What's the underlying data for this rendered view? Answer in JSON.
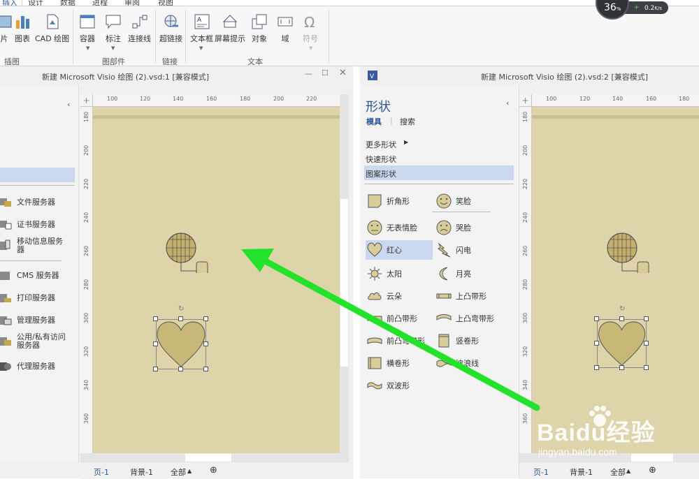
{
  "ribbon": {
    "tabs": [
      "插入",
      "设计",
      "数据",
      "进程",
      "审阅",
      "视图"
    ],
    "buttons": [
      {
        "label": "片"
      },
      {
        "label": "图表"
      },
      {
        "label": "CAD 绘图"
      },
      {
        "label": "容器"
      },
      {
        "label": "标注"
      },
      {
        "label": "连接线"
      },
      {
        "label": "超链接"
      },
      {
        "label": "文本框"
      },
      {
        "label": "屏幕提示"
      },
      {
        "label": "对象"
      },
      {
        "label": "域"
      },
      {
        "label": "符号"
      }
    ],
    "groups": [
      "插图",
      "图部件",
      "链接",
      "文本"
    ]
  },
  "network_widget": {
    "percent": "36",
    "percent_unit": "%",
    "speed": "0.2",
    "speed_unit": "K/s"
  },
  "left_window": {
    "title": "新建 Microsoft Visio 绘图 (2).vsd:1  [兼容模式]",
    "servers": [
      "文件服务器",
      "证书服务器",
      "移动信息服务器",
      "CMS 服务器",
      "打印服务器",
      "管理服务器",
      "公用/私有访问服务器",
      "代理服务器"
    ],
    "ruler_h": [
      "100",
      "120",
      "140",
      "160",
      "180",
      "200",
      "220"
    ],
    "ruler_v": [
      "180",
      "200",
      "220",
      "240",
      "260",
      "280",
      "300",
      "320",
      "340",
      "360",
      "380"
    ],
    "bottom_tabs": [
      "页-1",
      "背景-1",
      "全部"
    ]
  },
  "right_window": {
    "title": "新建 Microsoft Visio 绘图 (2).vsd:2  [兼容模式]",
    "shapes_title": "形状",
    "stencil_tab": "模具",
    "search_tab": "搜索",
    "menu": [
      "更多形状",
      "快速形状",
      "图案形状"
    ],
    "shapes": [
      [
        "折角形",
        "笑脸"
      ],
      [
        "无表情脸",
        "哭脸"
      ],
      [
        "红心",
        "闪电"
      ],
      [
        "太阳",
        "月亮"
      ],
      [
        "云朵",
        "上凸带形"
      ],
      [
        "前凸带形",
        "上凸弯带形"
      ],
      [
        "前凸弯带形",
        "竖卷形"
      ],
      [
        "横卷形",
        "波浪线"
      ],
      [
        "双波形"
      ]
    ],
    "ruler_h": [
      "100",
      "120",
      "140",
      "160",
      "180"
    ],
    "ruler_v": [
      "180",
      "200",
      "220",
      "240",
      "260",
      "280",
      "300",
      "320",
      "340",
      "360",
      "380"
    ],
    "bottom_tabs": [
      "页-1",
      "背景-1",
      "全部"
    ]
  },
  "watermark": {
    "brand": "Baidu经验",
    "url": "jingyan.baidu.com"
  }
}
